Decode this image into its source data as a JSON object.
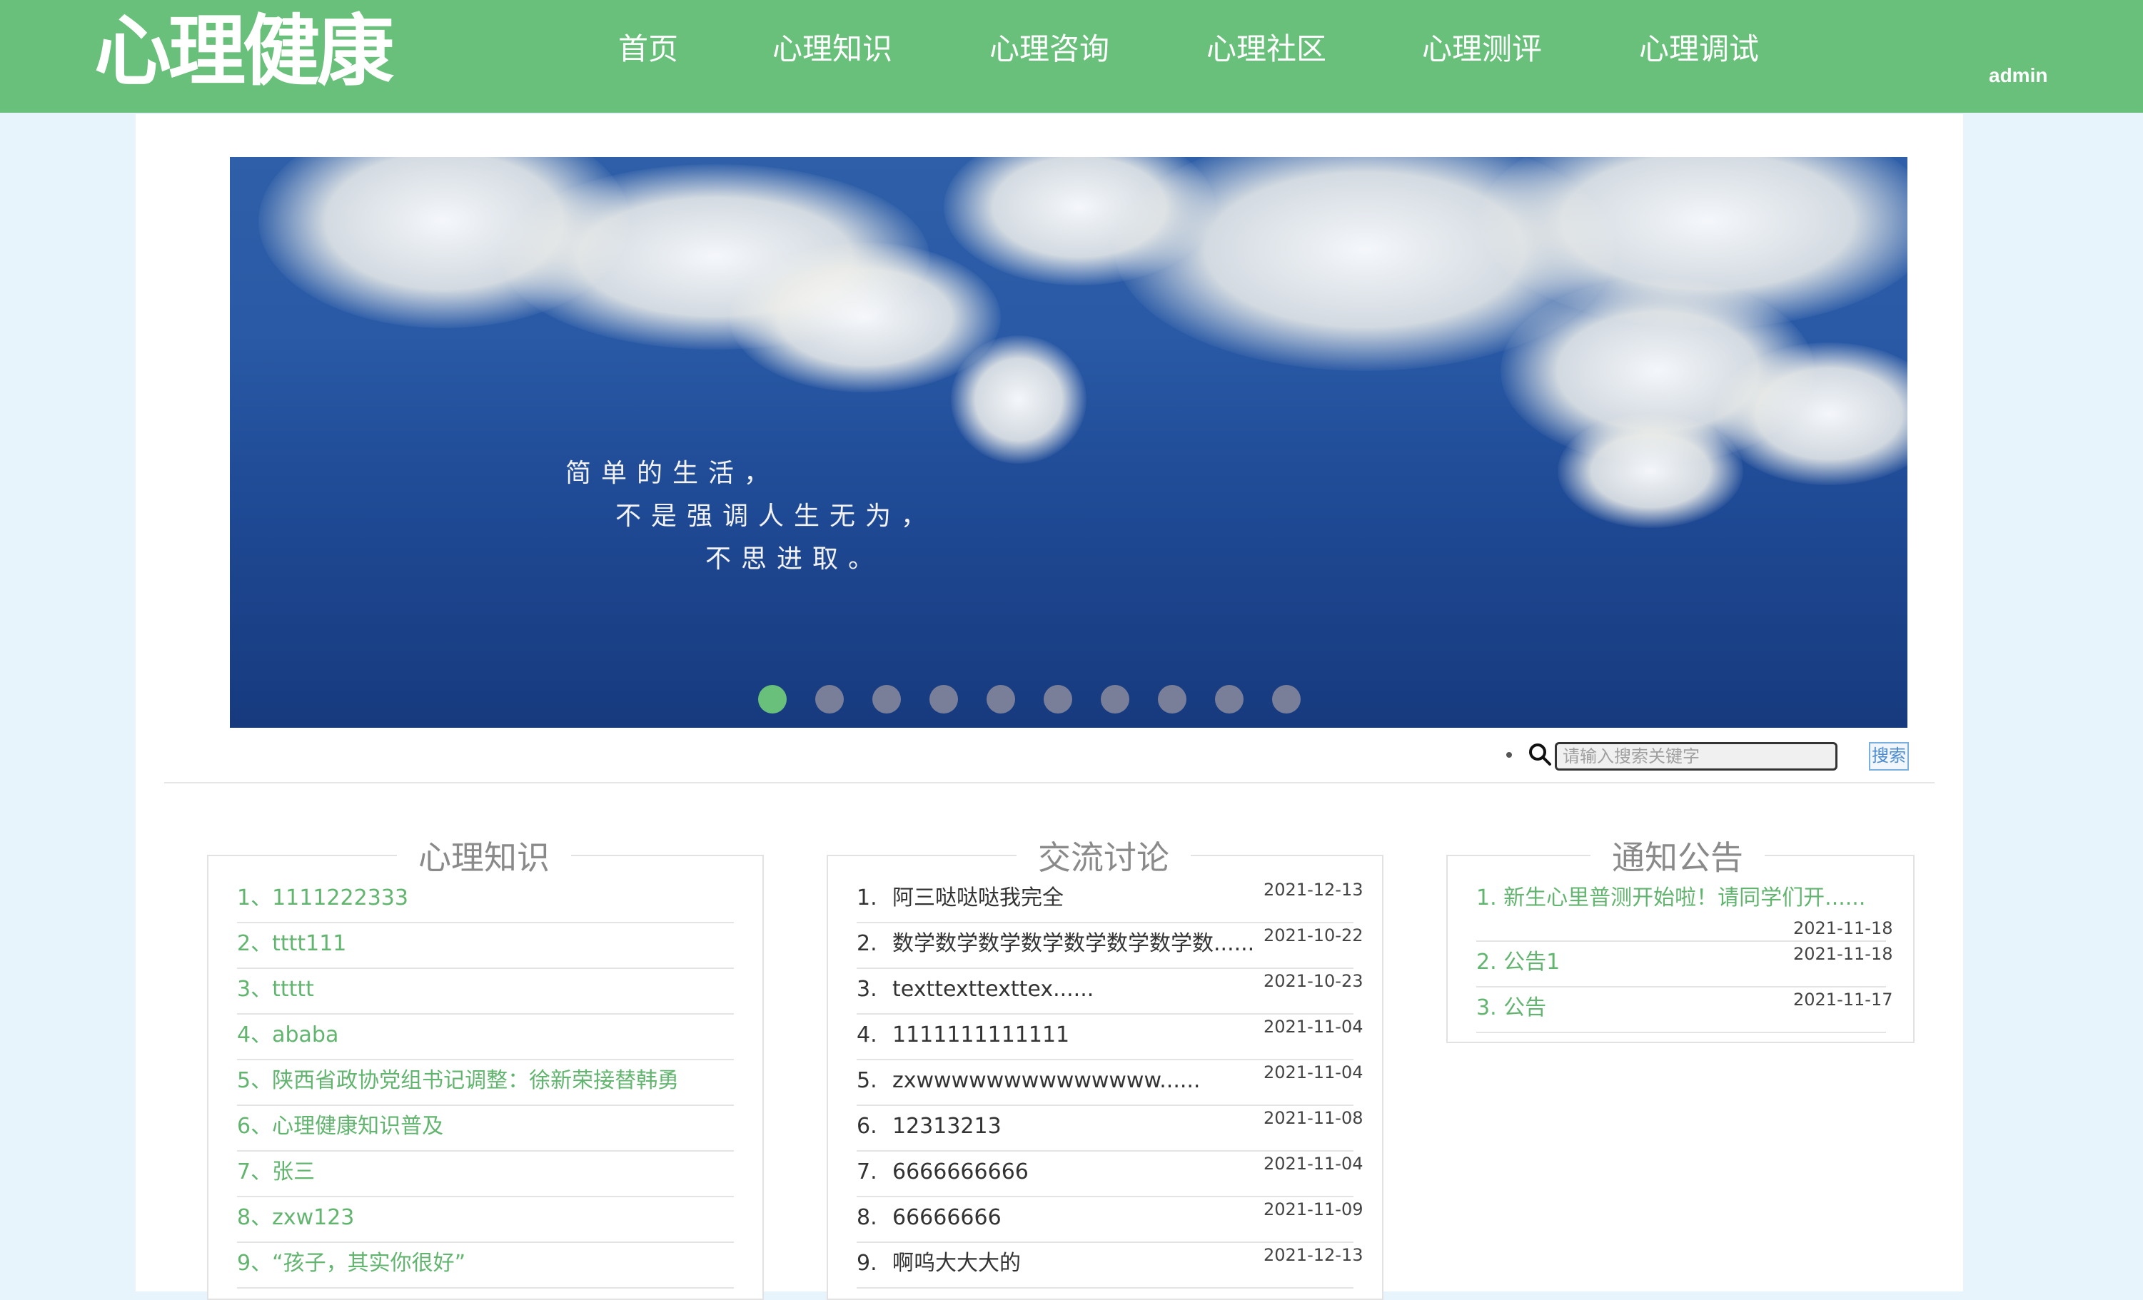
{
  "header": {
    "logo": "心理健康",
    "nav": [
      "首页",
      "心理知识",
      "心理咨询",
      "心理社区",
      "心理测评",
      "心理调试"
    ],
    "user": "admin"
  },
  "banner": {
    "poem_lines": [
      "简单的生活，",
      "不是强调人生无为，",
      "不思进取。"
    ],
    "slide_count": 10,
    "active_slide": 1
  },
  "search": {
    "placeholder": "请输入搜索关键字",
    "button_label": "搜索"
  },
  "knowledge": {
    "title": "心理知识",
    "items": [
      "1、1111222333",
      "2、tttt111",
      "3、ttttt",
      "4、ababa",
      "5、陕西省政协党组书记调整：徐新荣接替韩勇",
      "6、心理健康知识普及",
      "7、张三",
      "8、zxw123",
      "9、“孩子，其实你很好”"
    ]
  },
  "discussion": {
    "title": "交流讨论",
    "items": [
      {
        "index": "1.",
        "text": "阿三哒哒哒我完全",
        "date": "2021-12-13"
      },
      {
        "index": "2.",
        "text": "数学数学数学数学数学数学数学数......",
        "date": "2021-10-22"
      },
      {
        "index": "3.",
        "text": "texttexttexttex......",
        "date": "2021-10-23"
      },
      {
        "index": "4.",
        "text": "1111111111111",
        "date": "2021-11-04"
      },
      {
        "index": "5.",
        "text": "zxwwwwwwwwwwwwww......",
        "date": "2021-11-04"
      },
      {
        "index": "6.",
        "text": "12313213",
        "date": "2021-11-08"
      },
      {
        "index": "7.",
        "text": "6666666666",
        "date": "2021-11-04"
      },
      {
        "index": "8.",
        "text": "66666666",
        "date": "2021-11-09"
      },
      {
        "index": "9.",
        "text": "啊呜大大大的",
        "date": "2021-12-13"
      }
    ]
  },
  "notices": {
    "title": "通知公告",
    "items": [
      {
        "text": "1. 新生心里普测开始啦！请同学们开......",
        "date": "2021-11-18"
      },
      {
        "text": "2. 公告1",
        "date": "2021-11-18"
      },
      {
        "text": "3. 公告",
        "date": "2021-11-17"
      }
    ]
  },
  "colors": {
    "header_green": "#68c07a",
    "link_green": "#62b56f",
    "banner_blue": "#1f4a95"
  }
}
